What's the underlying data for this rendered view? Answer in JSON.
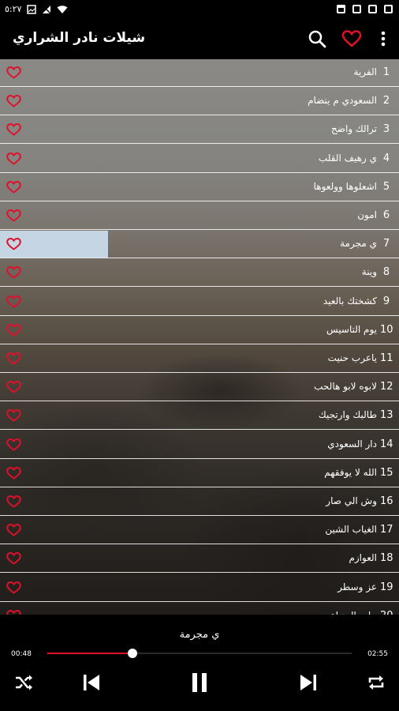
{
  "status_bar": {
    "time": "٥:٢٧"
  },
  "app_bar": {
    "title": "شيلات نادر الشراري"
  },
  "songs": [
    {
      "num": "1",
      "title": "الفرية"
    },
    {
      "num": "2",
      "title": "السعودي م ينضام"
    },
    {
      "num": "3",
      "title": "ترالك واضح"
    },
    {
      "num": "4",
      "title": "ي رهيف القلب"
    },
    {
      "num": "5",
      "title": "اشعلوها وولعوها"
    },
    {
      "num": "6",
      "title": "امون"
    },
    {
      "num": "7",
      "title": "ي مجرمة"
    },
    {
      "num": "8",
      "title": "وينة"
    },
    {
      "num": "9",
      "title": "كشختك بالعيد"
    },
    {
      "num": "10",
      "title": "يوم التاسيس"
    },
    {
      "num": "11",
      "title": "ياعرب حنيت"
    },
    {
      "num": "12",
      "title": "لابوه لابو هالحب"
    },
    {
      "num": "13",
      "title": "طالبك وارتجيك"
    },
    {
      "num": "14",
      "title": "دار السعودي"
    },
    {
      "num": "15",
      "title": "الله لا يوفقهم"
    },
    {
      "num": "16",
      "title": "وش الي صار"
    },
    {
      "num": "17",
      "title": "الغياب الشين"
    },
    {
      "num": "18",
      "title": "العوازم"
    },
    {
      "num": "19",
      "title": "عز وسطر"
    },
    {
      "num": "20",
      "title": "جات العديلة"
    }
  ],
  "active_index": 6,
  "player": {
    "now_playing": "ي مجرمة",
    "current_time": "00:48",
    "total_time": "02:55",
    "progress": 0.28
  },
  "colors": {
    "accent": "#e0102a",
    "highlight": "#c5d5e3"
  },
  "icons": {
    "app_bar": [
      "search-icon",
      "heart-icon",
      "more-vert-icon"
    ],
    "row": "heart-outline-icon",
    "player": [
      "shuffle-icon",
      "skip-previous-icon",
      "pause-icon",
      "skip-next-icon",
      "repeat-icon"
    ]
  }
}
